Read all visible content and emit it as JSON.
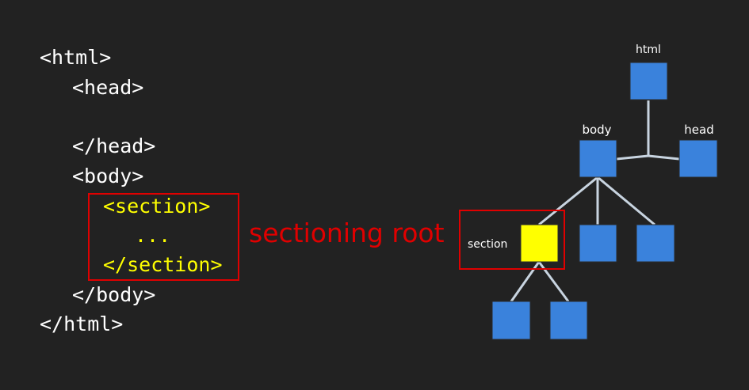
{
  "code": {
    "lines": [
      {
        "text": "<html>",
        "highlight": false
      },
      {
        "text": "<head>",
        "highlight": false
      },
      {
        "text": "",
        "highlight": false
      },
      {
        "text": "</head>",
        "highlight": false
      },
      {
        "text": "<body>",
        "highlight": false
      },
      {
        "text": "<section>",
        "highlight": true
      },
      {
        "text": "...",
        "highlight": true
      },
      {
        "text": "</section>",
        "highlight": true
      },
      {
        "text": "</body>",
        "highlight": false
      },
      {
        "text": "</html>",
        "highlight": false
      }
    ]
  },
  "annotation": {
    "label": "sectioning root"
  },
  "tree": {
    "labels": {
      "html": "html",
      "body": "body",
      "head": "head",
      "section": "section"
    }
  },
  "colors": {
    "background": "#222222",
    "code_text": "#ffffff",
    "code_highlight": "#ffff00",
    "annotation": "#e00000",
    "node_fill": "#3a82dc",
    "node_highlight": "#ffff00",
    "edge": "#c8d4e0"
  }
}
